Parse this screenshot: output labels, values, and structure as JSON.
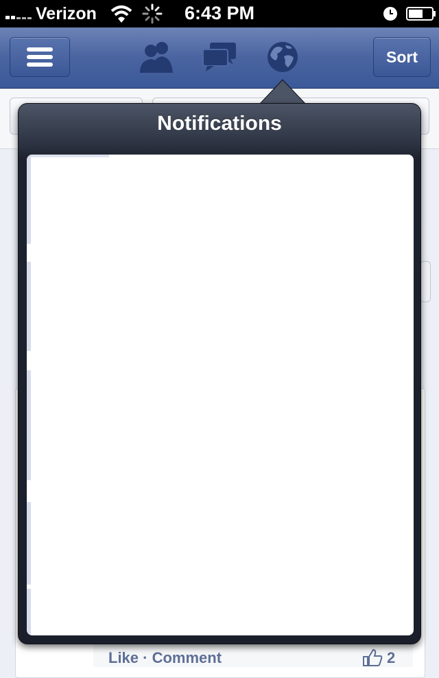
{
  "status_bar": {
    "carrier": "Verizon",
    "time": "6:43 PM"
  },
  "navbar": {
    "menu_icon": "menu-icon",
    "friends_icon": "friends-icon",
    "messages_icon": "messages-icon",
    "notifications_icon": "globe-icon",
    "sort_label": "Sort"
  },
  "popover": {
    "title": "Notifications"
  },
  "feed": {
    "like_label": "Like · Comment",
    "like_count": "2"
  },
  "colors": {
    "nav_blue": "#3b5998",
    "popover_dark": "#1d222e",
    "feed_bg": "#eceff5"
  }
}
